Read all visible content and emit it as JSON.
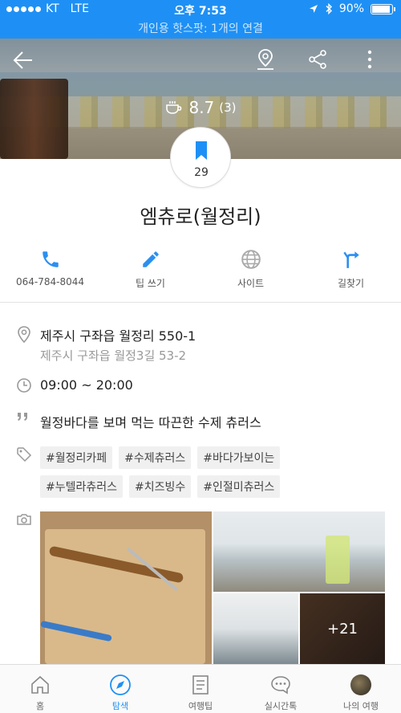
{
  "status_bar": {
    "carrier": "KT",
    "network": "LTE",
    "time": "오후 7:53",
    "battery": "90%",
    "battery_level": 0.9,
    "hotspot": "개인용 핫스팟: 1개의 연결"
  },
  "place": {
    "rating": "8.7",
    "rating_count": "(3)",
    "bookmark_count": "29",
    "name": "엠츄로(월정리)"
  },
  "actions": [
    {
      "label": "064-784-8044"
    },
    {
      "label": "팁 쓰기"
    },
    {
      "label": "사이트"
    },
    {
      "label": "길찾기"
    }
  ],
  "info": {
    "address": "제주시 구좌읍 월정리 550-1",
    "road_address": "제주시 구좌읍 월정3길 53-2",
    "hours": "09:00 ~ 20:00",
    "description": "월정바다를 보며 먹는 따끈한 수제 츄러스",
    "tags": [
      "#월정리카페",
      "#수제츄러스",
      "#바다가보이는",
      "#누텔라츄러스",
      "#치즈빙수",
      "#인절미츄러스"
    ]
  },
  "photos": {
    "more_count": "+21"
  },
  "tabbar": [
    {
      "label": "홈"
    },
    {
      "label": "탐색"
    },
    {
      "label": "여행팁"
    },
    {
      "label": "실시간톡"
    },
    {
      "label": "나의 여행"
    }
  ],
  "colors": {
    "accent": "#1e90f5",
    "icon_blue": "#2b8ff0",
    "icon_gray": "#aaaaaa"
  }
}
